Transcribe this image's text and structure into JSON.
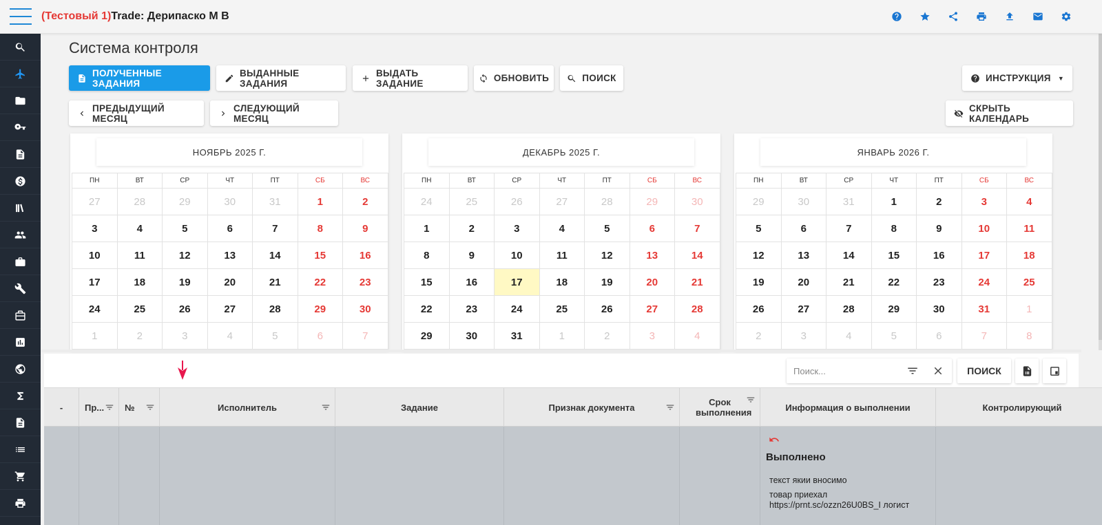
{
  "app": {
    "title_prefix": "(Тестовый 1)",
    "title_main": "Trade: Дерипаско М В"
  },
  "top_icons": [
    "help-icon",
    "star-icon",
    "share-icon",
    "print-icon",
    "upload-icon",
    "mail-icon",
    "settings-icon"
  ],
  "sidebar": {
    "items": [
      "search-icon",
      "airplane-icon",
      "folder-icon",
      "key-icon",
      "document-icon",
      "dollar-icon",
      "books-icon",
      "people-icon",
      "briefcase-icon",
      "wrench-icon",
      "box-icon",
      "chart-icon",
      "globe-icon",
      "sigma-icon",
      "file-icon",
      "list-icon",
      "cart-icon",
      "print-icon"
    ],
    "active_index": 1
  },
  "page": {
    "title": "Система контроля"
  },
  "toolbar": {
    "received": "ПОЛУЧЕННЫЕ ЗАДАНИЯ",
    "issued": "ВЫДАННЫЕ ЗАДАНИЯ",
    "issue_task": "ВЫДАТЬ ЗАДАНИЕ",
    "refresh": "ОБНОВИТЬ",
    "search": "ПОИСК",
    "instruction": "ИНСТРУКЦИЯ",
    "prev_month": "ПРЕДЫДУЩИЙ МЕСЯЦ",
    "next_month": "СЛЕДУЮЩИЙ МЕСЯЦ",
    "hide_calendar": "СКРЫТЬ КАЛЕНДАРЬ"
  },
  "weekdays": [
    "ПН",
    "ВТ",
    "СР",
    "ЧТ",
    "ПТ",
    "СБ",
    "ВС"
  ],
  "calendars": [
    {
      "title": "НОЯБРЬ 2025 Г.",
      "weeks": [
        [
          [
            27,
            0
          ],
          [
            28,
            0
          ],
          [
            29,
            0
          ],
          [
            30,
            0
          ],
          [
            31,
            0
          ],
          [
            1,
            1
          ],
          [
            2,
            1
          ]
        ],
        [
          [
            3,
            1
          ],
          [
            4,
            1
          ],
          [
            5,
            1
          ],
          [
            6,
            1
          ],
          [
            7,
            1
          ],
          [
            8,
            1
          ],
          [
            9,
            1
          ]
        ],
        [
          [
            10,
            1
          ],
          [
            11,
            1
          ],
          [
            12,
            1
          ],
          [
            13,
            1
          ],
          [
            14,
            1
          ],
          [
            15,
            1
          ],
          [
            16,
            1
          ]
        ],
        [
          [
            17,
            1
          ],
          [
            18,
            1
          ],
          [
            19,
            1
          ],
          [
            20,
            1
          ],
          [
            21,
            1
          ],
          [
            22,
            1
          ],
          [
            23,
            1
          ]
        ],
        [
          [
            24,
            1
          ],
          [
            25,
            1
          ],
          [
            26,
            1
          ],
          [
            27,
            1
          ],
          [
            28,
            1
          ],
          [
            29,
            1
          ],
          [
            30,
            1
          ]
        ],
        [
          [
            1,
            0
          ],
          [
            2,
            0
          ],
          [
            3,
            0
          ],
          [
            4,
            0
          ],
          [
            5,
            0
          ],
          [
            6,
            0
          ],
          [
            7,
            0
          ]
        ]
      ],
      "today": null
    },
    {
      "title": "ДЕКАБРЬ 2025 Г.",
      "weeks": [
        [
          [
            24,
            0
          ],
          [
            25,
            0
          ],
          [
            26,
            0
          ],
          [
            27,
            0
          ],
          [
            28,
            0
          ],
          [
            29,
            0
          ],
          [
            30,
            0
          ]
        ],
        [
          [
            1,
            1
          ],
          [
            2,
            1
          ],
          [
            3,
            1
          ],
          [
            4,
            1
          ],
          [
            5,
            1
          ],
          [
            6,
            1
          ],
          [
            7,
            1
          ]
        ],
        [
          [
            8,
            1
          ],
          [
            9,
            1
          ],
          [
            10,
            1
          ],
          [
            11,
            1
          ],
          [
            12,
            1
          ],
          [
            13,
            1
          ],
          [
            14,
            1
          ]
        ],
        [
          [
            15,
            1
          ],
          [
            16,
            1
          ],
          [
            17,
            1
          ],
          [
            18,
            1
          ],
          [
            19,
            1
          ],
          [
            20,
            1
          ],
          [
            21,
            1
          ]
        ],
        [
          [
            22,
            1
          ],
          [
            23,
            1
          ],
          [
            24,
            1
          ],
          [
            25,
            1
          ],
          [
            26,
            1
          ],
          [
            27,
            1
          ],
          [
            28,
            1
          ]
        ],
        [
          [
            29,
            1
          ],
          [
            30,
            1
          ],
          [
            31,
            1
          ],
          [
            1,
            0
          ],
          [
            2,
            0
          ],
          [
            3,
            0
          ],
          [
            4,
            0
          ]
        ]
      ],
      "today": 17
    },
    {
      "title": "ЯНВАРЬ 2026 Г.",
      "weeks": [
        [
          [
            29,
            0
          ],
          [
            30,
            0
          ],
          [
            31,
            0
          ],
          [
            1,
            1
          ],
          [
            2,
            1
          ],
          [
            3,
            1
          ],
          [
            4,
            1
          ]
        ],
        [
          [
            5,
            1
          ],
          [
            6,
            1
          ],
          [
            7,
            1
          ],
          [
            8,
            1
          ],
          [
            9,
            1
          ],
          [
            10,
            1
          ],
          [
            11,
            1
          ]
        ],
        [
          [
            12,
            1
          ],
          [
            13,
            1
          ],
          [
            14,
            1
          ],
          [
            15,
            1
          ],
          [
            16,
            1
          ],
          [
            17,
            1
          ],
          [
            18,
            1
          ]
        ],
        [
          [
            19,
            1
          ],
          [
            20,
            1
          ],
          [
            21,
            1
          ],
          [
            22,
            1
          ],
          [
            23,
            1
          ],
          [
            24,
            1
          ],
          [
            25,
            1
          ]
        ],
        [
          [
            26,
            1
          ],
          [
            27,
            1
          ],
          [
            28,
            1
          ],
          [
            29,
            1
          ],
          [
            30,
            1
          ],
          [
            31,
            1
          ],
          [
            1,
            0
          ]
        ],
        [
          [
            2,
            0
          ],
          [
            3,
            0
          ],
          [
            4,
            0
          ],
          [
            5,
            0
          ],
          [
            6,
            0
          ],
          [
            7,
            0
          ],
          [
            8,
            0
          ]
        ]
      ],
      "today": null
    }
  ],
  "grid": {
    "search_placeholder": "Поиск...",
    "search_button": "ПОИСК",
    "columns": [
      {
        "label": "-",
        "filter": false
      },
      {
        "label": "Пр...",
        "filter": true
      },
      {
        "label": "№",
        "filter": true
      },
      {
        "label": "Исполнитель",
        "filter": true
      },
      {
        "label": "Задание",
        "filter": false
      },
      {
        "label": "Признак документа",
        "filter": true
      },
      {
        "label": "Срок выполнения",
        "filter": true
      },
      {
        "label": "Информация о выполнении",
        "filter": false
      },
      {
        "label": "Контролирующий",
        "filter": false
      }
    ],
    "row": {
      "status": "Выполнено",
      "line1": "текст якии вносимо",
      "line2": "товар приехал https://prnt.sc/ozzn26U0BS_I логист"
    }
  },
  "colors": {
    "accent": "#1a9be8",
    "weekend": "#e53935",
    "today": "#fff9c4",
    "sidebar": "#222a35"
  }
}
